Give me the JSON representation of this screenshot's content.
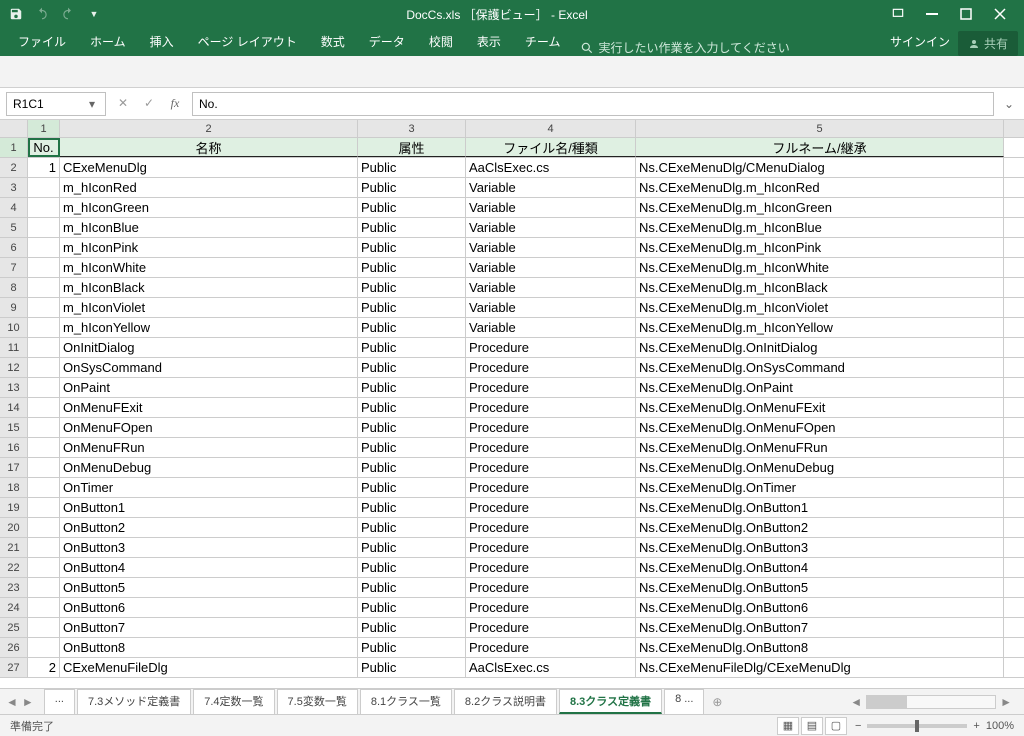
{
  "title": "DocCs.xls ［保護ビュー］ - Excel",
  "qat": {
    "save_icon": "save",
    "undo_icon": "undo",
    "redo_icon": "redo",
    "dd_icon": "chevron-down"
  },
  "tabs": [
    "ファイル",
    "ホーム",
    "挿入",
    "ページ レイアウト",
    "数式",
    "データ",
    "校閲",
    "表示",
    "チーム"
  ],
  "tellme_placeholder": "実行したい作業を入力してください",
  "signin": "サインイン",
  "share": "共有",
  "namebox": "R1C1",
  "formula_value": "No.",
  "col_headers": [
    "1",
    "2",
    "3",
    "4",
    "5"
  ],
  "header_row": [
    "No.",
    "名称",
    "属性",
    "ファイル名/種類",
    "フルネーム/継承"
  ],
  "rows": [
    [
      "1",
      "CExeMenuDlg",
      "Public",
      "AaClsExec.cs",
      "Ns.CExeMenuDlg/CMenuDialog"
    ],
    [
      "",
      "m_hIconRed",
      "Public",
      "Variable",
      "Ns.CExeMenuDlg.m_hIconRed"
    ],
    [
      "",
      "m_hIconGreen",
      "Public",
      "Variable",
      "Ns.CExeMenuDlg.m_hIconGreen"
    ],
    [
      "",
      "m_hIconBlue",
      "Public",
      "Variable",
      "Ns.CExeMenuDlg.m_hIconBlue"
    ],
    [
      "",
      "m_hIconPink",
      "Public",
      "Variable",
      "Ns.CExeMenuDlg.m_hIconPink"
    ],
    [
      "",
      "m_hIconWhite",
      "Public",
      "Variable",
      "Ns.CExeMenuDlg.m_hIconWhite"
    ],
    [
      "",
      "m_hIconBlack",
      "Public",
      "Variable",
      "Ns.CExeMenuDlg.m_hIconBlack"
    ],
    [
      "",
      "m_hIconViolet",
      "Public",
      "Variable",
      "Ns.CExeMenuDlg.m_hIconViolet"
    ],
    [
      "",
      "m_hIconYellow",
      "Public",
      "Variable",
      "Ns.CExeMenuDlg.m_hIconYellow"
    ],
    [
      "",
      "OnInitDialog",
      "Public",
      "Procedure",
      "Ns.CExeMenuDlg.OnInitDialog"
    ],
    [
      "",
      "OnSysCommand",
      "Public",
      "Procedure",
      "Ns.CExeMenuDlg.OnSysCommand"
    ],
    [
      "",
      "OnPaint",
      "Public",
      "Procedure",
      "Ns.CExeMenuDlg.OnPaint"
    ],
    [
      "",
      "OnMenuFExit",
      "Public",
      "Procedure",
      "Ns.CExeMenuDlg.OnMenuFExit"
    ],
    [
      "",
      "OnMenuFOpen",
      "Public",
      "Procedure",
      "Ns.CExeMenuDlg.OnMenuFOpen"
    ],
    [
      "",
      "OnMenuFRun",
      "Public",
      "Procedure",
      "Ns.CExeMenuDlg.OnMenuFRun"
    ],
    [
      "",
      "OnMenuDebug",
      "Public",
      "Procedure",
      "Ns.CExeMenuDlg.OnMenuDebug"
    ],
    [
      "",
      "OnTimer",
      "Public",
      "Procedure",
      "Ns.CExeMenuDlg.OnTimer"
    ],
    [
      "",
      "OnButton1",
      "Public",
      "Procedure",
      "Ns.CExeMenuDlg.OnButton1"
    ],
    [
      "",
      "OnButton2",
      "Public",
      "Procedure",
      "Ns.CExeMenuDlg.OnButton2"
    ],
    [
      "",
      "OnButton3",
      "Public",
      "Procedure",
      "Ns.CExeMenuDlg.OnButton3"
    ],
    [
      "",
      "OnButton4",
      "Public",
      "Procedure",
      "Ns.CExeMenuDlg.OnButton4"
    ],
    [
      "",
      "OnButton5",
      "Public",
      "Procedure",
      "Ns.CExeMenuDlg.OnButton5"
    ],
    [
      "",
      "OnButton6",
      "Public",
      "Procedure",
      "Ns.CExeMenuDlg.OnButton6"
    ],
    [
      "",
      "OnButton7",
      "Public",
      "Procedure",
      "Ns.CExeMenuDlg.OnButton7"
    ],
    [
      "",
      "OnButton8",
      "Public",
      "Procedure",
      "Ns.CExeMenuDlg.OnButton8"
    ],
    [
      "2",
      "CExeMenuFileDlg",
      "Public",
      "AaClsExec.cs",
      "Ns.CExeMenuFileDlg/CExeMenuDlg"
    ]
  ],
  "sheet_tabs": [
    "...",
    "7.3メソッド定義書",
    "7.4定数一覧",
    "7.5変数一覧",
    "8.1クラス一覧",
    "8.2クラス説明書",
    "8.3クラス定義書",
    "8 ..."
  ],
  "active_sheet": "8.3クラス定義書",
  "status": "準備完了",
  "zoom": "100%"
}
